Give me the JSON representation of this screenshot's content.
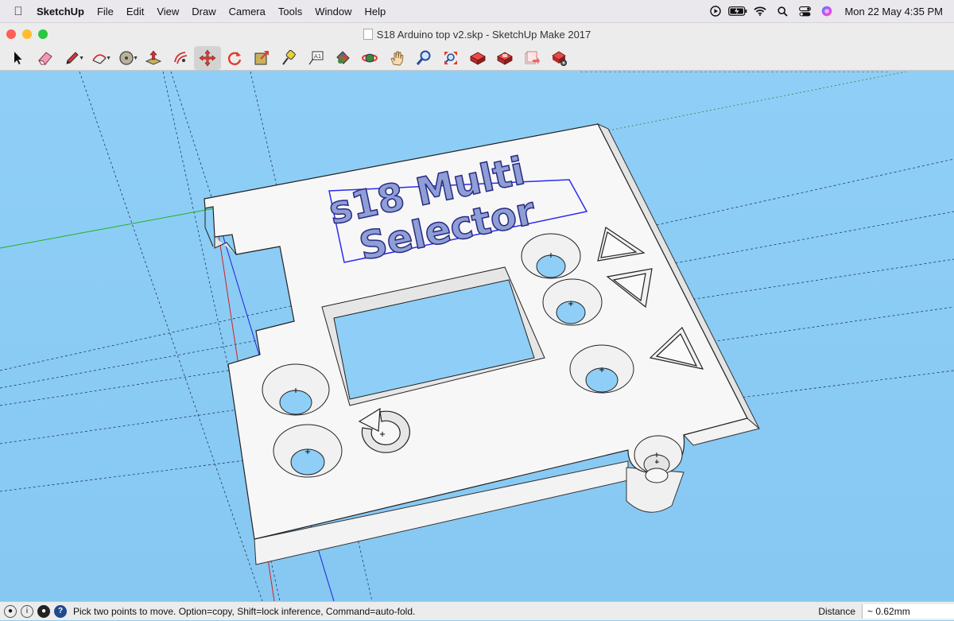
{
  "menubar": {
    "app_name": "SketchUp",
    "items": [
      "File",
      "Edit",
      "View",
      "Draw",
      "Camera",
      "Tools",
      "Window",
      "Help"
    ],
    "clock": "Mon 22 May  4:35 PM"
  },
  "window": {
    "title": "S18 Arduino top v2.skp - SketchUp Make 2017",
    "colors": {
      "close": "#fe5f57",
      "minimize": "#febc2e",
      "maximize": "#28c840"
    }
  },
  "toolbar": {
    "tools": [
      "select",
      "eraser",
      "line",
      "arc",
      "shapes",
      "push-pull",
      "offset",
      "move",
      "rotate",
      "scale",
      "tape-measure",
      "text",
      "paint-bucket",
      "orbit",
      "pan",
      "zoom",
      "zoom-extents",
      "3d-warehouse",
      "extension-warehouse",
      "layout",
      "extension-manager"
    ],
    "active": "move"
  },
  "model": {
    "text_line1": "s18 Multi",
    "text_line2": "Selector"
  },
  "status": {
    "hint": "Pick two points to move.  Option=copy, Shift=lock inference, Command=auto-fold.",
    "measure_label": "Distance",
    "measure_value": "~ 0.62mm"
  }
}
